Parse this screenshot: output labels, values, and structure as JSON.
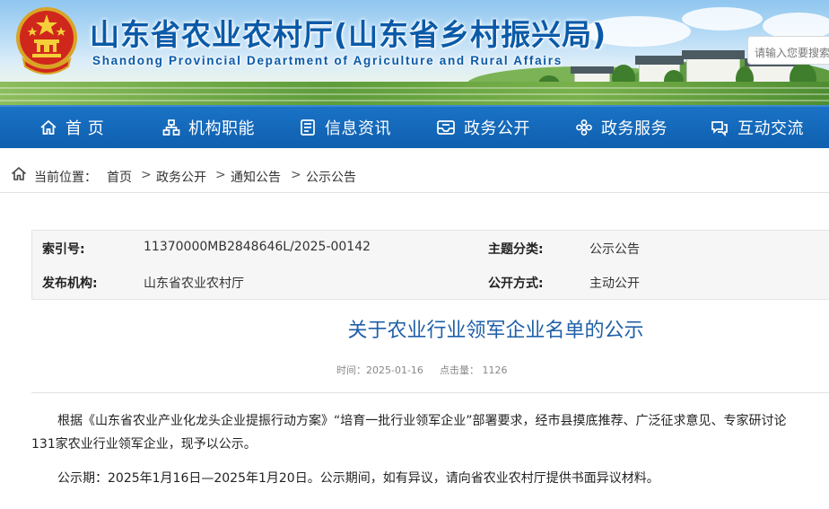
{
  "header": {
    "title": "山东省农业农村厅(山东省乡村振兴局)",
    "subtitle": "Shandong Provincial Department of Agriculture and Rural Affairs",
    "search_placeholder": "请输入您要搜索"
  },
  "nav": {
    "items": [
      {
        "label": "首  页",
        "icon": "home-icon"
      },
      {
        "label": "机构职能",
        "icon": "org-chart-icon"
      },
      {
        "label": "信息资讯",
        "icon": "document-icon"
      },
      {
        "label": "政务公开",
        "icon": "inbox-icon"
      },
      {
        "label": "政务服务",
        "icon": "flower-icon"
      },
      {
        "label": "互动交流",
        "icon": "chat-icon"
      }
    ]
  },
  "breadcrumb": {
    "label": "当前位置：",
    "items": [
      "首页",
      "政务公开",
      "通知公告",
      "公示公告"
    ],
    "separator": ">"
  },
  "info": {
    "index_no_label": "索引号:",
    "index_no": "11370000MB2848646L/2025-00142",
    "category_label": "主题分类:",
    "category": "公示公告",
    "publisher_label": "发布机构:",
    "publisher": "山东省农业农村厅",
    "disclosure_label": "公开方式:",
    "disclosure": "主动公开"
  },
  "article": {
    "title": "关于农业行业领军企业名单的公示",
    "time": "时间：2025-01-16",
    "views": "点击量：   1126",
    "para1_line1": "根据《山东省农业产业化龙头企业提振行动方案》“培育一批行业领军企业”部署要求，经市县摸底推荐、广泛征求意见、专家研讨论",
    "para1_line2": "131家农业行业领军企业，现予以公示。",
    "para2": "公示期：2025年1月16日—2025年1月20日。公示期间，如有异议，请向省农业农村厅提供书面异议材料。"
  },
  "colors": {
    "nav_bg": "#1267b8",
    "title_blue": "#0a5aa8",
    "article_title": "#1f5fa8"
  }
}
